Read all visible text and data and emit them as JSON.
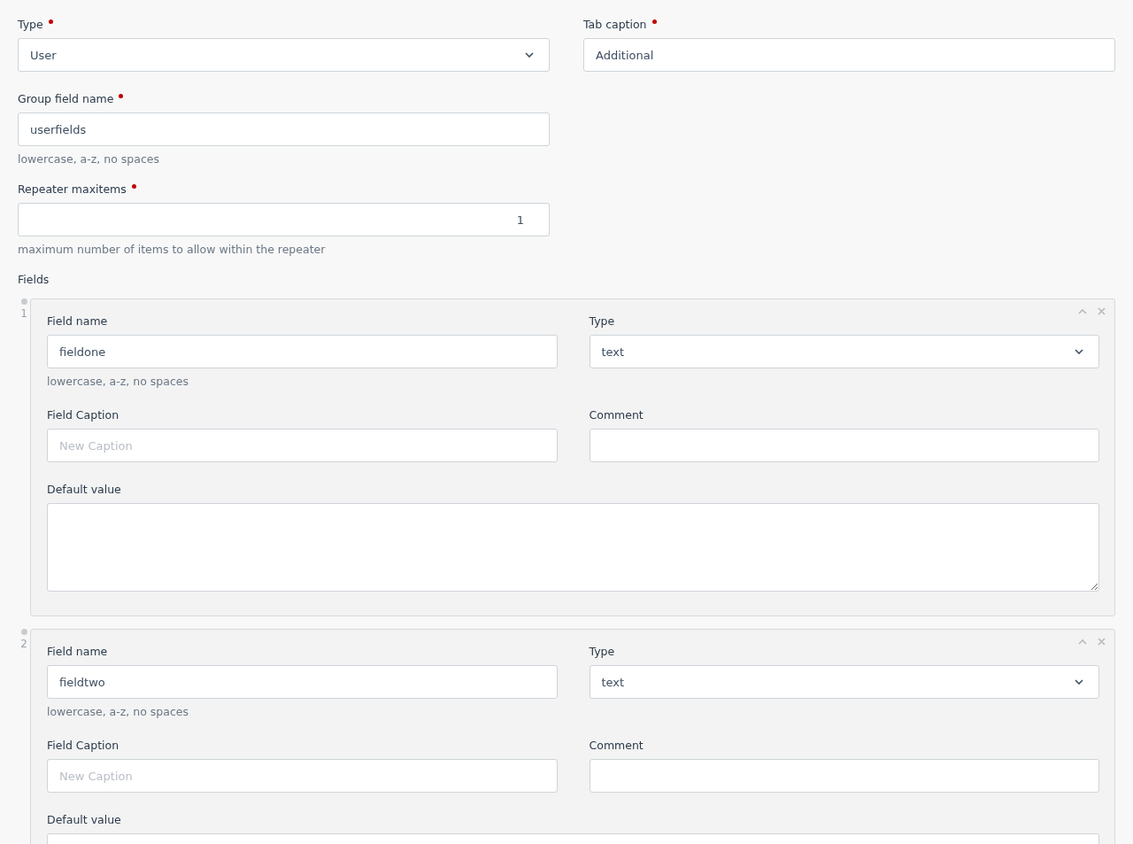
{
  "form": {
    "rows": [
      [
        {
          "kind": "select",
          "label": "Type",
          "required": true,
          "value": "User"
        },
        {
          "kind": "text",
          "label": "Tab caption",
          "required": true,
          "value": "Additional"
        }
      ],
      [
        {
          "kind": "text",
          "label": "Group field name",
          "required": true,
          "value": "userfields",
          "help": "lowercase, a-z, no spaces"
        }
      ],
      [
        {
          "kind": "number",
          "label": "Repeater maxitems",
          "required": true,
          "value": "1",
          "help": "maximum number of items to allow within the repeater"
        }
      ]
    ]
  },
  "repeater": {
    "label": "Fields",
    "items": [
      {
        "number": "1",
        "rows": [
          [
            {
              "kind": "text",
              "label": "Field name",
              "value": "fieldone",
              "help": "lowercase, a-z, no spaces"
            },
            {
              "kind": "select",
              "label": "Type",
              "value": "text"
            }
          ],
          [
            {
              "kind": "text",
              "label": "Field Caption",
              "placeholder": "New Caption"
            },
            {
              "kind": "text",
              "label": "Comment"
            }
          ],
          [
            {
              "kind": "textarea",
              "label": "Default value"
            }
          ]
        ]
      },
      {
        "number": "2",
        "rows": [
          [
            {
              "kind": "text",
              "label": "Field name",
              "value": "fieldtwo",
              "help": "lowercase, a-z, no spaces"
            },
            {
              "kind": "select",
              "label": "Type",
              "value": "text"
            }
          ],
          [
            {
              "kind": "text",
              "label": "Field Caption",
              "placeholder": "New Caption"
            },
            {
              "kind": "text",
              "label": "Comment"
            }
          ],
          [
            {
              "kind": "textarea",
              "label": "Default value"
            }
          ]
        ]
      }
    ]
  }
}
